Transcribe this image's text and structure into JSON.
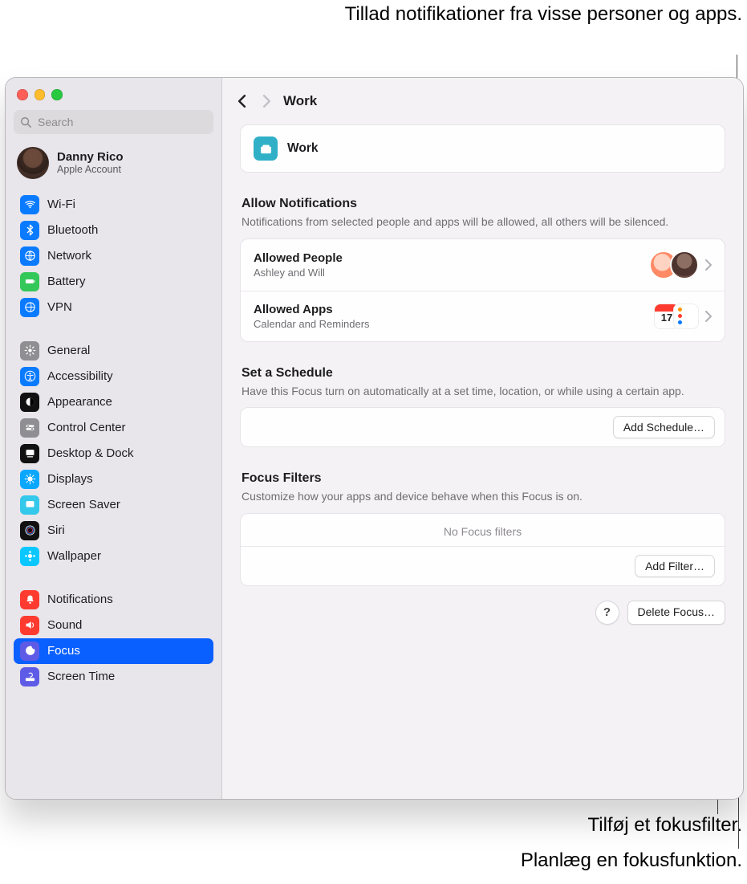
{
  "callouts": {
    "top": "Tillad notifikationer fra visse personer og apps.",
    "bottom_filter": "Tilføj et fokusfilter.",
    "bottom_schedule": "Planlæg en fokusfunktion."
  },
  "search": {
    "placeholder": "Search"
  },
  "account": {
    "name": "Danny Rico",
    "subtitle": "Apple Account"
  },
  "sidebar": {
    "group1": [
      {
        "label": "Wi-Fi",
        "iconName": "wifi-icon",
        "bg": "#0a7bff"
      },
      {
        "label": "Bluetooth",
        "iconName": "bluetooth-icon",
        "bg": "#0a7bff"
      },
      {
        "label": "Network",
        "iconName": "network-icon",
        "bg": "#0a7bff"
      },
      {
        "label": "Battery",
        "iconName": "battery-icon",
        "bg": "#34c759"
      },
      {
        "label": "VPN",
        "iconName": "vpn-icon",
        "bg": "#0a7bff"
      }
    ],
    "group2": [
      {
        "label": "General",
        "iconName": "gear-icon",
        "bg": "#8e8e93"
      },
      {
        "label": "Accessibility",
        "iconName": "accessibility-icon",
        "bg": "#0a7bff"
      },
      {
        "label": "Appearance",
        "iconName": "appearance-icon",
        "bg": "#111"
      },
      {
        "label": "Control Center",
        "iconName": "control-center-icon",
        "bg": "#8e8e93"
      },
      {
        "label": "Desktop & Dock",
        "iconName": "desktop-dock-icon",
        "bg": "#111"
      },
      {
        "label": "Displays",
        "iconName": "displays-icon",
        "bg": "#0aa7ff"
      },
      {
        "label": "Screen Saver",
        "iconName": "screen-saver-icon",
        "bg": "#34c8eb"
      },
      {
        "label": "Siri",
        "iconName": "siri-icon",
        "bg": "#111"
      },
      {
        "label": "Wallpaper",
        "iconName": "wallpaper-icon",
        "bg": "#0ac8ff"
      }
    ],
    "group3": [
      {
        "label": "Notifications",
        "iconName": "notifications-icon",
        "bg": "#ff3b30"
      },
      {
        "label": "Sound",
        "iconName": "sound-icon",
        "bg": "#ff3b30"
      },
      {
        "label": "Focus",
        "iconName": "focus-icon",
        "bg": "#5e5ce6",
        "active": true
      },
      {
        "label": "Screen Time",
        "iconName": "screen-time-icon",
        "bg": "#5e5ce6"
      }
    ]
  },
  "title": "Work",
  "focusHeader": {
    "label": "Work"
  },
  "allowSection": {
    "title": "Allow Notifications",
    "sub": "Notifications from selected people and apps will be allowed, all others will be silenced.",
    "people": {
      "title": "Allowed People",
      "sub": "Ashley and Will"
    },
    "apps": {
      "title": "Allowed Apps",
      "sub": "Calendar and Reminders"
    }
  },
  "scheduleSection": {
    "title": "Set a Schedule",
    "sub": "Have this Focus turn on automatically at a set time, location, or while using a certain app.",
    "addBtn": "Add Schedule…"
  },
  "filtersSection": {
    "title": "Focus Filters",
    "sub": "Customize how your apps and device behave when this Focus is on.",
    "empty": "No Focus filters",
    "addBtn": "Add Filter…"
  },
  "footer": {
    "help": "?",
    "deleteBtn": "Delete Focus…"
  }
}
